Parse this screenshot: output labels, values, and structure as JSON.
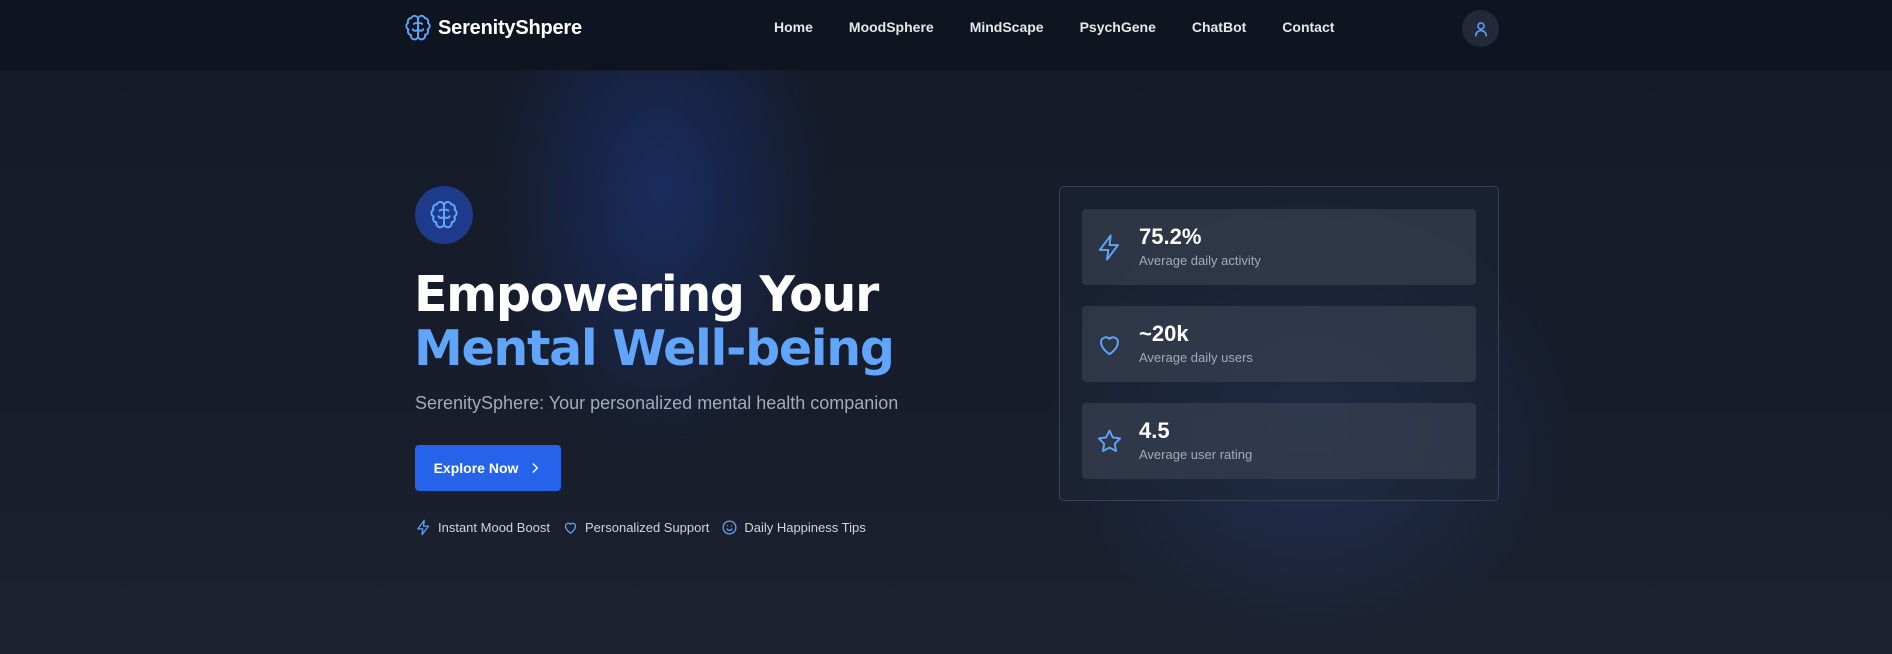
{
  "brand": {
    "name": "SerenityShpere"
  },
  "nav": {
    "items": [
      "Home",
      "MoodSphere",
      "MindScape",
      "PsychGene",
      "ChatBot",
      "Contact"
    ]
  },
  "hero": {
    "title_line1": "Empowering Your",
    "title_line2": "Mental Well-being",
    "subtitle": "SerenitySphere: Your personalized mental health companion",
    "cta_label": "Explore Now",
    "features": [
      {
        "icon": "bolt-icon",
        "label": "Instant Mood Boost"
      },
      {
        "icon": "heart-icon",
        "label": "Personalized Support"
      },
      {
        "icon": "smile-icon",
        "label": "Daily Happiness Tips"
      }
    ]
  },
  "stats": [
    {
      "icon": "bolt-icon",
      "value": "75.2%",
      "label": "Average daily activity"
    },
    {
      "icon": "heart-icon",
      "value": "~20k",
      "label": "Average daily users"
    },
    {
      "icon": "star-icon",
      "value": "4.5",
      "label": "Average user rating"
    }
  ],
  "colors": {
    "accent": "#60a5fa",
    "button": "#2563eb",
    "background": "#161c2a",
    "icon_circle": "#1e3a8a"
  }
}
